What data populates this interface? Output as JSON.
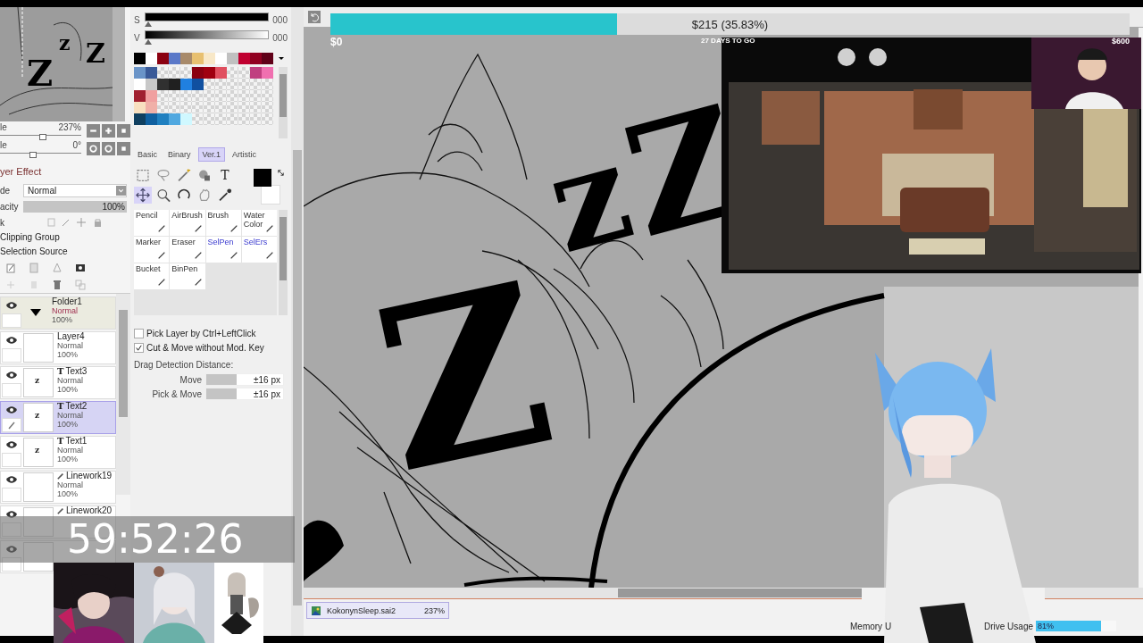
{
  "navigator": {
    "letters": [
      "z",
      "Z",
      "Z"
    ]
  },
  "view": [
    {
      "label": "le",
      "value": "237%",
      "level": 0.52
    },
    {
      "label": "le",
      "value": "0°",
      "level": 0.4
    }
  ],
  "layer_effect": {
    "title": "yer Effect",
    "mode_label": "de",
    "mode": "Normal",
    "opacity": {
      "label": "acity",
      "value": "100%",
      "level": 1
    },
    "lock_label": "k",
    "options": [
      "Clipping Group",
      "Selection Source"
    ]
  },
  "layers": [
    {
      "kind": "folder",
      "name": "Folder1",
      "mode": "Normal",
      "opacity": "100%",
      "selected": false,
      "expanded": true
    },
    {
      "kind": "layer",
      "name": "Layer4",
      "mode": "Normal",
      "opacity": "100%",
      "selected": false
    },
    {
      "kind": "text",
      "glyph": "T",
      "thumb": "z",
      "name": "Text3",
      "mode": "Normal",
      "opacity": "100%",
      "selected": false
    },
    {
      "kind": "text",
      "glyph": "T",
      "thumb": "z",
      "name": "Text2",
      "mode": "Normal",
      "opacity": "100%",
      "selected": true
    },
    {
      "kind": "text",
      "glyph": "T",
      "thumb": "z",
      "name": "Text1",
      "mode": "Normal",
      "opacity": "100%",
      "selected": false
    },
    {
      "kind": "linework",
      "name": "Linework19",
      "mode": "Normal",
      "opacity": "100%",
      "selected": false
    },
    {
      "kind": "linework",
      "name": "Linework20",
      "selected": false
    },
    {
      "kind": "linework",
      "selected": false
    }
  ],
  "color": [
    {
      "label": "S",
      "value": "000",
      "level": 0
    },
    {
      "label": "V",
      "value": "000",
      "level": 0
    }
  ],
  "palette": {
    "top": [
      {
        "color": "#000000"
      },
      {
        "color": "#ffffff"
      },
      {
        "color": "#8b0010"
      },
      {
        "color": "#5a78c8"
      },
      {
        "color": "#a88a6a"
      },
      {
        "color": "#e8c070"
      },
      {
        "color": "#f8e8c8"
      },
      {
        "color": "#ffffff"
      },
      {
        "color": "#c0c0c0"
      },
      {
        "color": "#c00030"
      },
      {
        "color": "#900020"
      },
      {
        "color": "#600018"
      }
    ],
    "grid": [
      [
        {
          "kind": "swatch",
          "color": "#6a94c8"
        },
        {
          "kind": "swatch",
          "color": "#3a5a98"
        },
        {
          "kind": "empty"
        },
        {
          "kind": "empty"
        },
        {
          "kind": "empty"
        },
        {
          "kind": "swatch",
          "color": "#8b0010"
        },
        {
          "kind": "swatch",
          "color": "#a00010"
        },
        {
          "kind": "swatch",
          "color": "#e05060"
        },
        {
          "kind": "empty"
        },
        {
          "kind": "empty"
        },
        {
          "kind": "swatch",
          "color": "#c04080"
        },
        {
          "kind": "swatch",
          "color": "#f070b0"
        }
      ],
      [
        {
          "kind": "swatch",
          "color": "#ffffff"
        },
        {
          "kind": "swatch",
          "color": "#c8c8c8"
        },
        {
          "kind": "swatch",
          "color": "#303030"
        },
        {
          "kind": "swatch",
          "color": "#202020"
        },
        {
          "kind": "swatch",
          "color": "#2080e0"
        },
        {
          "kind": "swatch",
          "color": "#1050a0"
        },
        {
          "kind": "empty"
        },
        {
          "kind": "empty"
        },
        {
          "kind": "empty"
        },
        {
          "kind": "empty"
        },
        {
          "kind": "empty"
        },
        {
          "kind": "empty"
        }
      ],
      [
        {
          "kind": "swatch",
          "color": "#a02030"
        },
        {
          "kind": "swatch",
          "color": "#f0a0a0"
        },
        {
          "kind": "empty"
        },
        {
          "kind": "empty"
        },
        {
          "kind": "empty"
        },
        {
          "kind": "empty"
        },
        {
          "kind": "empty"
        },
        {
          "kind": "empty"
        },
        {
          "kind": "empty"
        },
        {
          "kind": "empty"
        },
        {
          "kind": "empty"
        },
        {
          "kind": "empty"
        }
      ],
      [
        {
          "kind": "swatch",
          "color": "#f8e0c0"
        },
        {
          "kind": "swatch",
          "color": "#f0b0a8"
        },
        {
          "kind": "empty"
        },
        {
          "kind": "empty"
        },
        {
          "kind": "empty"
        },
        {
          "kind": "empty"
        },
        {
          "kind": "empty"
        },
        {
          "kind": "empty"
        },
        {
          "kind": "empty"
        },
        {
          "kind": "empty"
        },
        {
          "kind": "empty"
        },
        {
          "kind": "empty"
        }
      ],
      [
        {
          "kind": "swatch",
          "color": "#104060"
        },
        {
          "kind": "swatch",
          "color": "#1060a0"
        },
        {
          "kind": "swatch",
          "color": "#2080c0"
        },
        {
          "kind": "swatch",
          "color": "#50a8e0"
        },
        {
          "kind": "swatch",
          "color": "#d0f8ff"
        },
        {
          "kind": "empty"
        },
        {
          "kind": "empty"
        },
        {
          "kind": "empty"
        },
        {
          "kind": "empty"
        },
        {
          "kind": "empty"
        },
        {
          "kind": "empty"
        },
        {
          "kind": "empty"
        }
      ]
    ]
  },
  "tool_tabs": [
    {
      "label": "Basic",
      "selected": false
    },
    {
      "label": "Binary",
      "selected": false
    },
    {
      "label": "Ver.1",
      "selected": true
    },
    {
      "label": "Artistic",
      "selected": false
    }
  ],
  "tools": {
    "text_glyph": "T",
    "foreground": {
      "color": "#000000"
    },
    "background": {
      "color": "#ffffff"
    }
  },
  "brushes": [
    {
      "label": "Pencil",
      "kind": "normal"
    },
    {
      "label": "AirBrush",
      "kind": "normal"
    },
    {
      "label": "Brush",
      "kind": "normal"
    },
    {
      "label": "Water Color",
      "kind": "normal"
    },
    {
      "label": "Marker",
      "kind": "normal"
    },
    {
      "label": "Eraser",
      "kind": "normal"
    },
    {
      "label": "SelPen",
      "kind": "selection"
    },
    {
      "label": "SelErs",
      "kind": "selection"
    },
    {
      "label": "Bucket",
      "kind": "normal"
    },
    {
      "label": "BinPen",
      "kind": "normal"
    }
  ],
  "options": {
    "checks": [
      {
        "label": "Pick Layer by Ctrl+LeftClick",
        "checked": false
      },
      {
        "label": "Cut & Move without Mod. Key",
        "checked": true
      }
    ],
    "drag_title": "Drag Detection Distance:",
    "distances": [
      {
        "label": "Move",
        "value": "±16 px",
        "level": 0.4
      },
      {
        "label": "Pick & Move",
        "value": "±16 px",
        "level": 0.4
      }
    ]
  },
  "canvas": {
    "letters": [
      "Z",
      "z",
      "Z"
    ]
  },
  "goal": {
    "amount": "$215 (35.83%)",
    "level": 0.3583,
    "start": "$0",
    "days": "27 DAYS TO GO",
    "target": "$600"
  },
  "timer": "59:52:26",
  "file_tab": {
    "name": "KokonynSleep.sai2",
    "zoom": "237%"
  },
  "status": {
    "memory_label": "Memory U",
    "drive_label": "Drive Usage",
    "drive_value": "81%",
    "level": 0.81
  }
}
